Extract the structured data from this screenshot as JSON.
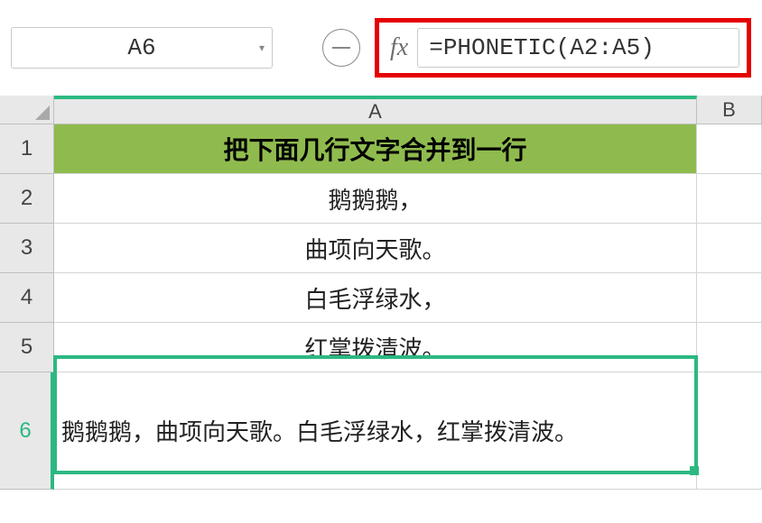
{
  "name_box": {
    "ref": "A6"
  },
  "formula_bar": {
    "value": "=PHONETIC(A2:A5)"
  },
  "columns": {
    "A": "A",
    "B": "B"
  },
  "row_labels": [
    "1",
    "2",
    "3",
    "4",
    "5",
    "6"
  ],
  "cells": {
    "A1": "把下面几行文字合并到一行",
    "A2": "鹅鹅鹅，",
    "A3": "曲项向天歌。",
    "A4": "白毛浮绿水，",
    "A5": "红掌拨清波。",
    "A6": "鹅鹅鹅，曲项向天歌。白毛浮绿水，红掌拨清波。"
  },
  "active_cell": "A6",
  "colors": {
    "highlight_red": "#e50000",
    "selection_green": "#2cb882",
    "header_fill": "#8fbb4e"
  }
}
